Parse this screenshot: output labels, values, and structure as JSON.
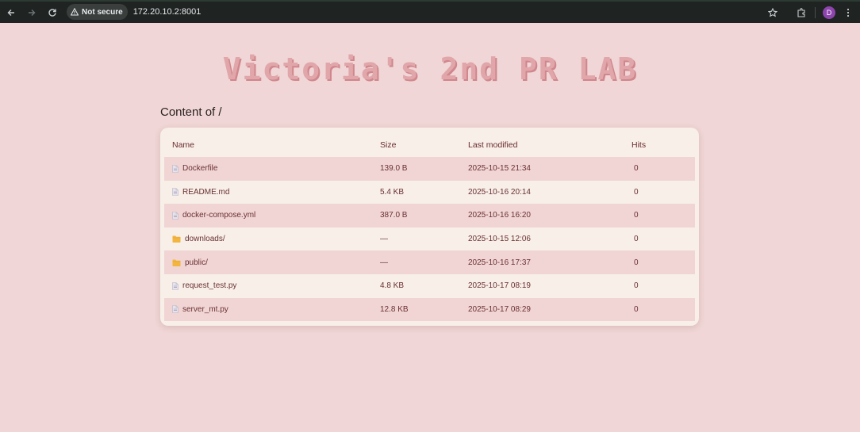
{
  "browser": {
    "security_label": "Not secure",
    "url": "172.20.10.2:8001",
    "profile_initial": "D",
    "icons": [
      "back-icon",
      "forward-icon",
      "reload-icon",
      "warning-icon",
      "star-icon",
      "extensions-icon",
      "menu-icon"
    ]
  },
  "page": {
    "title": "Victoria's 2nd PR LAB",
    "content_heading": "Content of /",
    "columns": {
      "name": "Name",
      "size": "Size",
      "modified": "Last modified",
      "hits": "Hits"
    },
    "rows": [
      {
        "name": "Dockerfile",
        "icon": "file-icon",
        "size": "139.0 B",
        "modified": "2025-10-15 21:34",
        "hits": "0"
      },
      {
        "name": "README.md",
        "icon": "file-icon",
        "size": "5.4 KB",
        "modified": "2025-10-16 20:14",
        "hits": "0"
      },
      {
        "name": "docker-compose.yml",
        "icon": "file-icon",
        "size": "387.0 B",
        "modified": "2025-10-16 16:20",
        "hits": "0"
      },
      {
        "name": "downloads/",
        "icon": "folder-icon",
        "size": "—",
        "modified": "2025-10-15 12:06",
        "hits": "0"
      },
      {
        "name": "public/",
        "icon": "folder-icon",
        "size": "—",
        "modified": "2025-10-16 17:37",
        "hits": "0"
      },
      {
        "name": "request_test.py",
        "icon": "file-icon",
        "size": "4.8 KB",
        "modified": "2025-10-17 08:19",
        "hits": "0"
      },
      {
        "name": "server_mt.py",
        "icon": "file-icon",
        "size": "12.8 KB",
        "modified": "2025-10-17 08:29",
        "hits": "0"
      }
    ]
  },
  "colors": {
    "background": "#f0d6d6",
    "card": "#f7efe8",
    "row_shaded": "#f0d5d4",
    "title": "#e0a6aa",
    "text": "#6b3034",
    "folder": "#f2b640"
  }
}
